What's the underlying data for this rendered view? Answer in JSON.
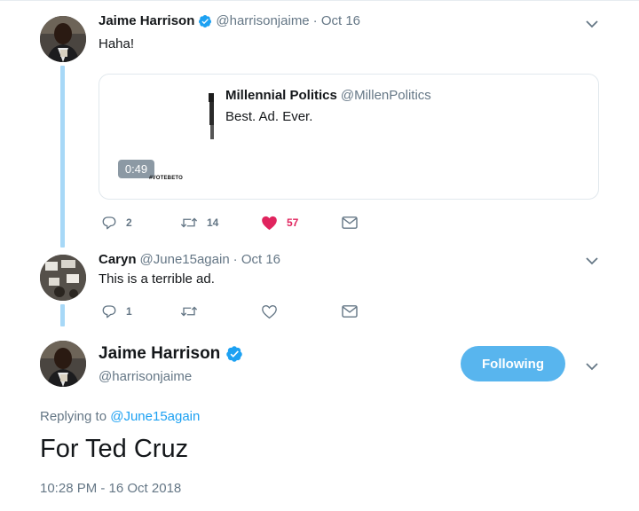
{
  "tweet1": {
    "name": "Jaime Harrison",
    "handle": "@harrisonjaime",
    "date": "· Oct 16",
    "text": "Haha!",
    "quote": {
      "name": "Millennial Politics",
      "handle": "@MillenPolitics",
      "text": "Best. Ad. Ever.",
      "duration": "0:49",
      "watermark": "#VOTEBETO"
    },
    "replies": "2",
    "retweets": "14",
    "likes": "57"
  },
  "tweet2": {
    "name": "Caryn",
    "handle": "@June15again",
    "date": "· Oct 16",
    "text": "This is a terrible ad.",
    "replies": "1"
  },
  "main": {
    "name": "Jaime Harrison",
    "handle": "@harrisonjaime",
    "follow_label": "Following",
    "replying_prefix": "Replying to",
    "replying_to": "@June15again",
    "text": "For Ted Cruz",
    "timestamp": "10:28 PM - 16 Oct 2018"
  },
  "colors": {
    "link": "#1da1f2",
    "like": "#e0245e",
    "follow_button": "#58b5ee",
    "thread_line": "#a7d8f7"
  }
}
